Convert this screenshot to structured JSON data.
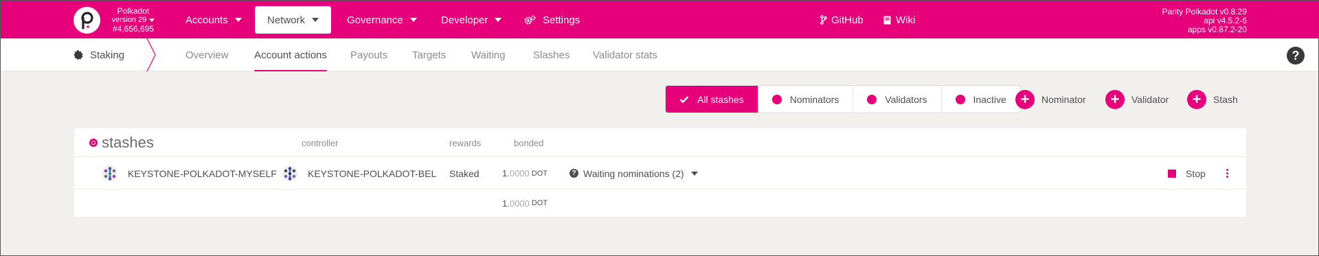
{
  "topbar": {
    "chain_name": "Polkadot",
    "chain_version": "version 29",
    "block_number": "#4,656,695",
    "nav": [
      {
        "label": "Accounts",
        "icon": "caret-down-icon"
      },
      {
        "label": "Network",
        "icon": "caret-down-icon"
      },
      {
        "label": "Governance",
        "icon": "caret-down-icon"
      },
      {
        "label": "Developer",
        "icon": "caret-down-icon"
      },
      {
        "label": "Settings",
        "icon": "gears-icon"
      }
    ],
    "links": [
      {
        "label": "GitHub",
        "icon": "code-branch-icon"
      },
      {
        "label": "Wiki",
        "icon": "book-icon"
      }
    ],
    "versions": [
      "Parity Polkadot v0.8.29",
      "api v4.5.2-6",
      "apps v0.87.2-20"
    ],
    "accent_color": "#e6007a"
  },
  "subnav": {
    "section": "Staking",
    "tabs": [
      "Overview",
      "Account actions",
      "Payouts",
      "Targets",
      "Waiting",
      "Slashes",
      "Validator stats"
    ],
    "active_tab": "Account actions"
  },
  "filters": {
    "items": [
      "All stashes",
      "Nominators",
      "Validators",
      "Inactive"
    ],
    "active": "All stashes"
  },
  "actions": [
    "Nominator",
    "Validator",
    "Stash"
  ],
  "table": {
    "title": "stashes",
    "headers": {
      "controller": "controller",
      "rewards": "rewards",
      "bonded": "bonded"
    },
    "rows": [
      {
        "stash": "KEYSTONE-POLKADOT-MYSELF",
        "controller": "KEYSTONE-POLKADOT-BEL",
        "rewards": "Staked",
        "bonded_int": "1.",
        "bonded_dec": "0000",
        "bonded_unit": "DOT",
        "status": "Waiting nominations (2)",
        "action": "Stop"
      }
    ],
    "total_int": "1.",
    "total_dec": "0000",
    "total_unit": "DOT"
  }
}
